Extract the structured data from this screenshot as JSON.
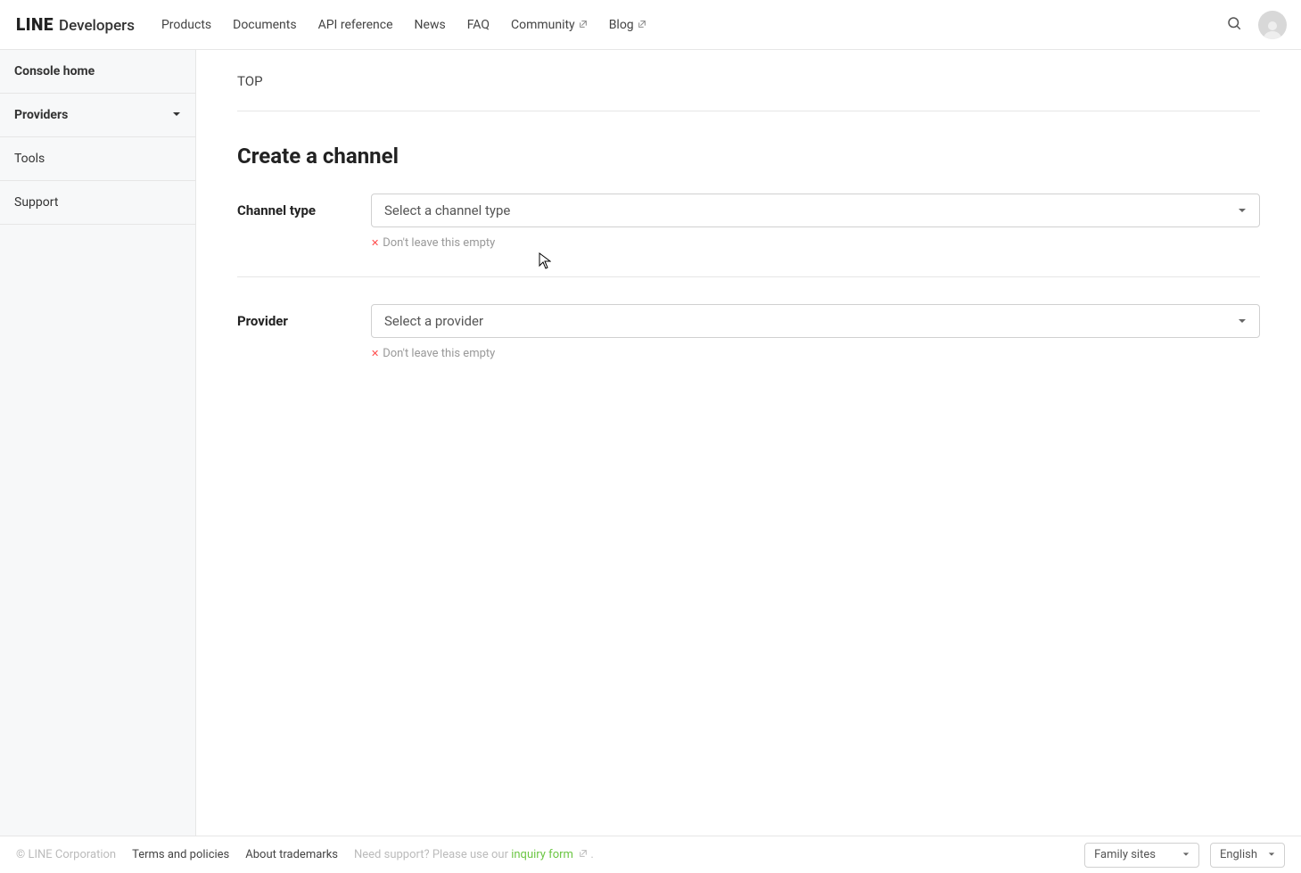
{
  "header": {
    "logo_line": "LINE",
    "logo_dev": "Developers",
    "nav": {
      "products": "Products",
      "documents": "Documents",
      "api_reference": "API reference",
      "news": "News",
      "faq": "FAQ",
      "community": "Community",
      "blog": "Blog"
    }
  },
  "sidebar": {
    "console_home": "Console home",
    "providers": "Providers",
    "tools": "Tools",
    "support": "Support"
  },
  "main": {
    "breadcrumb": "TOP",
    "title": "Create a channel",
    "channel_type": {
      "label": "Channel type",
      "placeholder": "Select a channel type",
      "validation": "Don't leave this empty"
    },
    "provider": {
      "label": "Provider",
      "placeholder": "Select a provider",
      "validation": "Don't leave this empty"
    }
  },
  "footer": {
    "copyright": "© LINE Corporation",
    "terms": "Terms and policies",
    "trademarks": "About trademarks",
    "support_prefix": "Need support? Please use our ",
    "inquiry": "inquiry form",
    "family_sites": "Family sites",
    "language": "English"
  }
}
